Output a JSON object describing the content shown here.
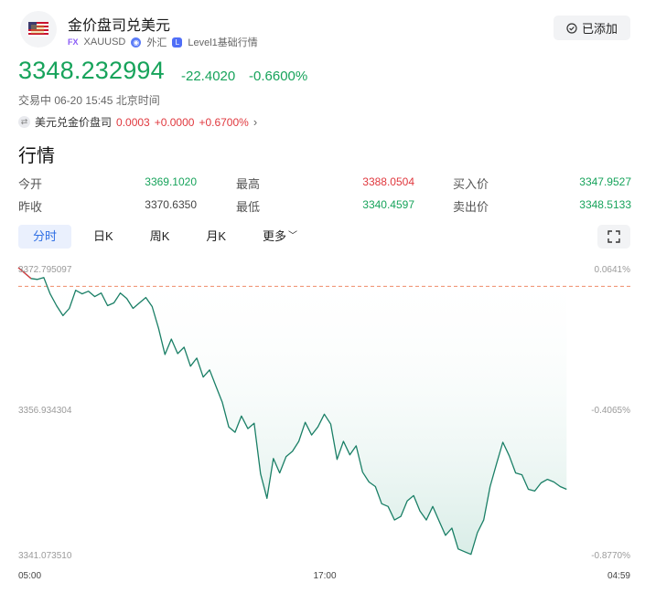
{
  "header": {
    "title": "金价盘司兑美元",
    "market_tag": "FX",
    "symbol": "XAUUSD",
    "category": "外汇",
    "level": "Level1基础行情",
    "added_label": "已添加"
  },
  "quote": {
    "price": "3348.232994",
    "change": "-22.4020",
    "change_pct": "-0.6600%",
    "status": "交易中 06-20 15:45 北京时间"
  },
  "related": {
    "name": "美元兑金价盘司",
    "price": "0.0003",
    "change": "+0.0000",
    "change_pct": "+0.6700%"
  },
  "section_title": "行情",
  "stats": {
    "open_label": "今开",
    "open": "3369.1020",
    "high_label": "最高",
    "high": "3388.0504",
    "bid_label": "买入价",
    "bid": "3347.9527",
    "prev_label": "昨收",
    "prev": "3370.6350",
    "low_label": "最低",
    "low": "3340.4597",
    "ask_label": "卖出价",
    "ask": "3348.5133"
  },
  "tabs": [
    "分时",
    "日K",
    "周K",
    "月K",
    "更多"
  ],
  "active_tab": "分时",
  "colors": {
    "up": "#e0383e",
    "down": "#17a35b",
    "line": "#1a7f66",
    "accent": "#2f6fe4"
  },
  "chart_data": {
    "type": "line",
    "y_axis_left": [
      "3372.795097",
      "3356.934304",
      "3341.073510"
    ],
    "y_axis_right": [
      "0.0641%",
      "-0.4065%",
      "-0.8770%"
    ],
    "x_axis": [
      "05:00",
      "17:00",
      "04:59"
    ],
    "ylim": [
      3341.07351,
      3372.795097
    ],
    "prev_close": 3370.635,
    "session_hours": 24,
    "series": [
      {
        "x_hours": [
          0,
          0.5,
          0.75,
          1.0,
          1.25,
          1.5,
          1.75,
          2.0,
          2.25,
          2.5,
          2.75,
          3.0,
          3.25,
          3.5,
          3.75,
          4.0,
          4.25,
          4.5,
          4.75,
          5.0,
          5.25,
          5.5,
          5.75,
          6.0,
          6.25,
          6.5,
          6.75,
          7.0,
          7.25,
          7.5,
          7.75,
          8.0,
          8.25,
          8.5,
          8.75,
          9.0,
          9.25,
          9.5,
          9.75,
          10.0,
          10.25,
          10.5,
          10.75,
          11.0,
          11.25,
          11.5,
          11.75,
          12.0,
          12.25,
          12.5,
          12.75,
          13.0,
          13.25,
          13.5,
          13.75,
          14.0,
          14.25,
          14.5,
          14.75,
          15.0,
          15.25,
          15.5,
          15.75,
          16.0,
          16.25,
          16.5,
          16.75,
          17.0,
          17.25,
          17.5,
          17.75,
          18.0,
          18.25,
          18.5,
          18.75,
          19.0,
          19.25,
          19.5,
          19.75,
          20.0,
          20.25,
          20.5,
          20.75,
          21.0,
          21.25,
          21.5
        ],
        "values": [
          3372.7,
          3371.5,
          3371.4,
          3371.6,
          3369.8,
          3368.5,
          3367.4,
          3368.2,
          3370.2,
          3369.8,
          3370.1,
          3369.5,
          3369.9,
          3368.5,
          3368.8,
          3369.9,
          3369.3,
          3368.2,
          3368.8,
          3369.4,
          3368.4,
          3366.0,
          3363.1,
          3364.8,
          3363.2,
          3363.9,
          3361.8,
          3362.7,
          3360.6,
          3361.4,
          3359.6,
          3357.8,
          3355.1,
          3354.5,
          3356.3,
          3354.9,
          3355.5,
          3349.9,
          3347.2,
          3351.6,
          3350.0,
          3351.8,
          3352.4,
          3353.5,
          3355.6,
          3354.2,
          3355.1,
          3356.5,
          3355.4,
          3351.5,
          3353.5,
          3352.0,
          3353.0,
          3350.1,
          3349.0,
          3348.5,
          3346.6,
          3346.3,
          3344.8,
          3345.2,
          3346.9,
          3347.5,
          3345.8,
          3344.8,
          3346.3,
          3344.7,
          3343.1,
          3343.9,
          3341.6,
          3341.3,
          3341.0,
          3343.4,
          3344.8,
          3348.5,
          3351.0,
          3353.4,
          3351.9,
          3350.0,
          3349.8,
          3348.2,
          3348.0,
          3348.9,
          3349.3,
          3349.0,
          3348.5,
          3348.2
        ]
      }
    ]
  }
}
